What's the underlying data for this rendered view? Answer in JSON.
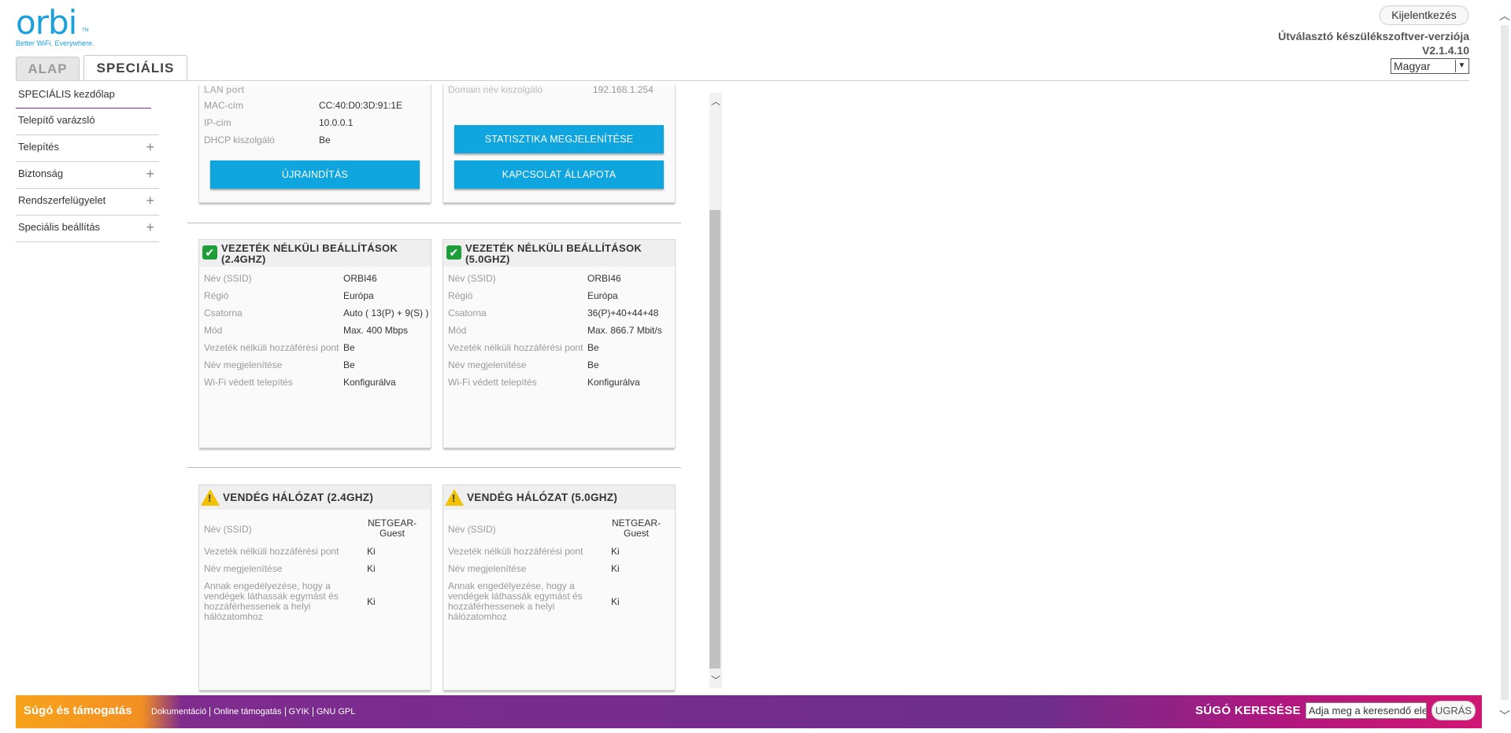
{
  "header": {
    "logo_text": "orbi",
    "logo_tm": "TM",
    "tagline": "Better WiFi. Everywhere.",
    "logout_label": "Kijelentkezés",
    "firmware_label": "Útválasztó készülékszoftver-verziója",
    "firmware_version": "V2.1.4.10",
    "language_selected": "Magyar"
  },
  "tabs": {
    "basic": "ALAP",
    "advanced": "SPECIÁLIS"
  },
  "sidebar": {
    "items": [
      {
        "label": "SPECIÁLIS kezdőlap"
      },
      {
        "label": "Telepítő varázsló"
      },
      {
        "label": "Telepítés"
      },
      {
        "label": "Biztonság"
      },
      {
        "label": "Rendszerfelügyelet"
      },
      {
        "label": "Speciális beállítás"
      }
    ]
  },
  "lan_panel": {
    "partial_title": "LAN port",
    "rows": [
      {
        "label": "MAC-cím",
        "value": "CC:40:D0:3D:91:1E"
      },
      {
        "label": "IP-cím",
        "value": "10.0.0.1"
      },
      {
        "label": "DHCP kiszolgáló",
        "value": "Be"
      }
    ],
    "restart_button": "ÚJRAINDÍTÁS"
  },
  "internet_panel": {
    "partial_label": "Domain név kiszolgáló",
    "partial_value": "192.168.1.254",
    "stats_button": "STATISZTIKA MEGJELENÍTÉSE",
    "status_button": "KAPCSOLAT ÁLLAPOTA"
  },
  "wireless_24": {
    "title": "VEZETÉK NÉLKÜLI BEÁLLÍTÁSOK (2.4GHZ)",
    "rows": [
      {
        "label": "Név (SSID)",
        "value": "ORBI46"
      },
      {
        "label": "Régió",
        "value": "Európa"
      },
      {
        "label": "Csatorna",
        "value": "Auto ( 13(P) + 9(S) )"
      },
      {
        "label": "Mód",
        "value": "Max. 400 Mbps"
      },
      {
        "label": "Vezeték nélküli hozzáférési pont",
        "value": "Be"
      },
      {
        "label": "Név megjelenítése",
        "value": "Be"
      },
      {
        "label": "Wi-Fi védett telepítés",
        "value": "Konfigurálva"
      }
    ]
  },
  "wireless_50": {
    "title": "VEZETÉK NÉLKÜLI BEÁLLÍTÁSOK (5.0GHZ)",
    "rows": [
      {
        "label": "Név (SSID)",
        "value": "ORBI46"
      },
      {
        "label": "Régió",
        "value": "Európa"
      },
      {
        "label": "Csatorna",
        "value": "36(P)+40+44+48"
      },
      {
        "label": "Mód",
        "value": "Max. 866.7 Mbit/s"
      },
      {
        "label": "Vezeték nélküli hozzáférési pont",
        "value": "Be"
      },
      {
        "label": "Név megjelenítése",
        "value": "Be"
      },
      {
        "label": "Wi-Fi védett telepítés",
        "value": "Konfigurálva"
      }
    ]
  },
  "guest_24": {
    "title": "VENDÉG HÁLÓZAT (2.4GHZ)",
    "rows": [
      {
        "label": "Név (SSID)",
        "value": "NETGEAR-Guest"
      },
      {
        "label": "Vezeték nélküli hozzáférési pont",
        "value": "Ki"
      },
      {
        "label": "Név megjelenítése",
        "value": "Ki"
      },
      {
        "label": "Annak engedélyezése, hogy a vendégek láthassák egymást és hozzáférhessenek a helyi hálózatomhoz",
        "value": "Ki"
      }
    ]
  },
  "guest_50": {
    "title": "VENDÉG HÁLÓZAT (5.0GHZ)",
    "rows": [
      {
        "label": "Név (SSID)",
        "value": "NETGEAR-Guest"
      },
      {
        "label": "Vezeték nélküli hozzáférési pont",
        "value": "Ki"
      },
      {
        "label": "Név megjelenítése",
        "value": "Ki"
      },
      {
        "label": "Annak engedélyezése, hogy a vendégek láthassák egymást és hozzáférhessenek a helyi hálózatomhoz",
        "value": "Ki"
      }
    ]
  },
  "footer": {
    "title": "Súgó és támogatás",
    "links": [
      "Dokumentáció",
      "Online támogatás",
      "GYIK",
      "GNU GPL"
    ],
    "search_label": "SÚGÓ KERESÉSE",
    "search_placeholder": "Adja meg a keresendő elemet",
    "go_button": "UGRÁS"
  },
  "colors": {
    "accent_blue": "#0fa5df",
    "brand_purple": "#6e2e8c",
    "footer_orange": "#f39024",
    "check_green": "#1e9e3a",
    "warning_yellow": "#f2c200"
  },
  "icons": {
    "enabled": "check-icon",
    "disabled": "warning-icon",
    "expand": "plus-icon",
    "select": "chevron-down-icon"
  }
}
